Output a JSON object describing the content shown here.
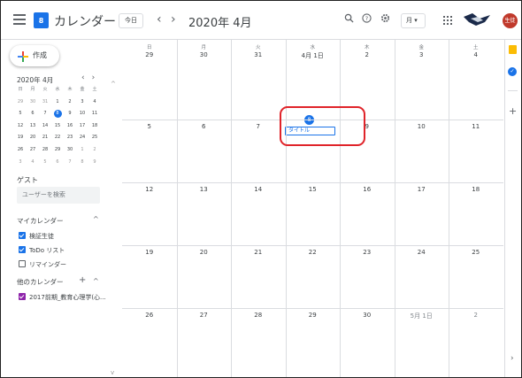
{
  "header": {
    "app_title": "カレンダー",
    "logo_day": "8",
    "today_label": "今日",
    "prev_label": "‹",
    "next_label": "›",
    "current_date": "2020年 4月",
    "view_label": "月 ▾",
    "avatar_text": "生徒",
    "icons": [
      "menu-icon",
      "calendar-logo-icon",
      "search-icon",
      "help-icon",
      "settings-icon",
      "apps-icon",
      "brand-logo-icon"
    ]
  },
  "sidebar": {
    "create_label": "作成",
    "mini_calendar": {
      "month_label": "2020年 4月",
      "prev": "‹",
      "next": "›",
      "weekdays": [
        "日",
        "月",
        "火",
        "水",
        "木",
        "金",
        "土"
      ],
      "weeks": [
        [
          "29",
          "30",
          "31",
          "1",
          "2",
          "3",
          "4"
        ],
        [
          "5",
          "6",
          "7",
          "8",
          "9",
          "10",
          "11"
        ],
        [
          "12",
          "13",
          "14",
          "15",
          "16",
          "17",
          "18"
        ],
        [
          "19",
          "20",
          "21",
          "22",
          "23",
          "24",
          "25"
        ],
        [
          "26",
          "27",
          "28",
          "29",
          "30",
          "1",
          "2"
        ],
        [
          "3",
          "4",
          "5",
          "6",
          "7",
          "8",
          "9"
        ]
      ],
      "selected": "8"
    },
    "guest_label": "ゲスト",
    "guest_search_placeholder": "ユーザーを検索",
    "my_calendars_label": "マイカレンダー",
    "my_calendars": [
      {
        "label": "検証生徒",
        "checked": true,
        "color": "#1a73e8"
      },
      {
        "label": "ToDo リスト",
        "checked": true,
        "color": "#1a73e8"
      },
      {
        "label": "リマインダー",
        "checked": false,
        "color": "#5f6368"
      }
    ],
    "other_calendars_label": "他のカレンダー",
    "other_calendars": [
      {
        "label": "2017前期_教育心理学(心...",
        "checked": true,
        "color": "#8e24aa"
      }
    ]
  },
  "calendar": {
    "day_names": [
      "日",
      "月",
      "火",
      "水",
      "木",
      "金",
      "土"
    ],
    "weeks": [
      [
        "29",
        "30",
        "31",
        "4月 1日",
        "2",
        "3",
        "4"
      ],
      [
        "5",
        "6",
        "7",
        "8",
        "9",
        "10",
        "11"
      ],
      [
        "12",
        "13",
        "14",
        "15",
        "16",
        "17",
        "18"
      ],
      [
        "19",
        "20",
        "21",
        "22",
        "23",
        "24",
        "25"
      ],
      [
        "26",
        "27",
        "28",
        "29",
        "30",
        "5月 1日",
        "2"
      ]
    ],
    "today": "8",
    "event": {
      "title": "タイトル",
      "day": "8"
    }
  },
  "colors": {
    "accent": "#1a73e8",
    "highlight_box": "#e0242a",
    "keep_yellow": "#fbbc04"
  }
}
